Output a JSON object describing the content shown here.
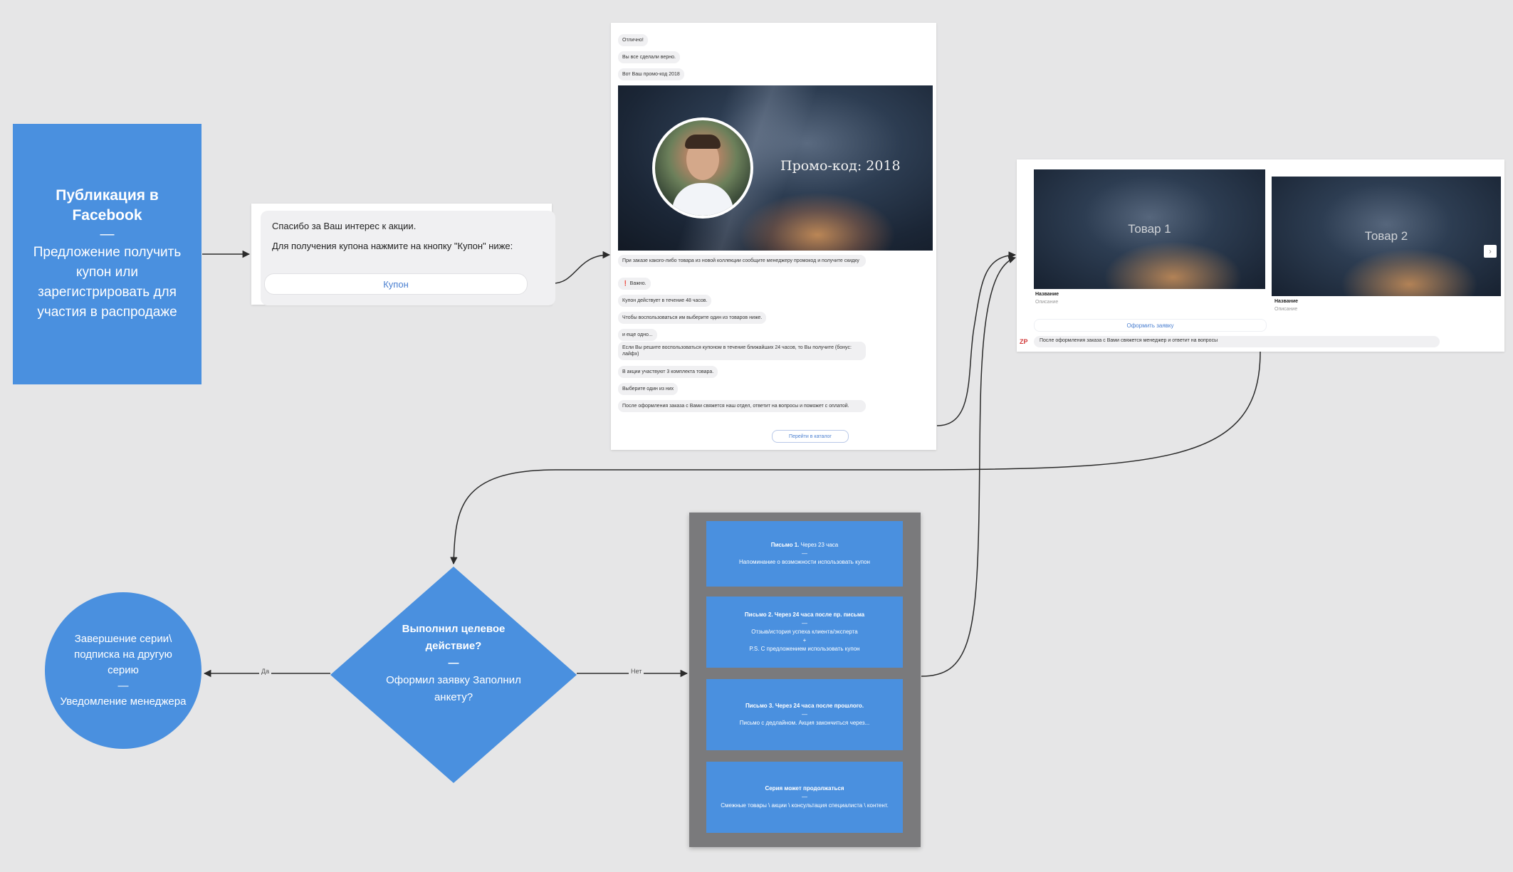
{
  "facebook_block": {
    "title": "Публикация в Facebook",
    "dash": "—",
    "subtitle": "Предложение получить купон или зарегистрировать для участия в распродаже"
  },
  "coupon_message": {
    "line1": "Спасибо за Ваш интерес к акции.",
    "line2": "Для получения купона нажмите на кнопку \"Купон\" ниже:",
    "button": "Купон"
  },
  "promo_chat": {
    "top_messages": [
      "Отлично!",
      "Вы все сделали верно.",
      "Вот Ваш промо-код 2018"
    ],
    "hero_text": "Промо-код: 2018",
    "messages": [
      "При заказе какого-либо товара из новой коллекции сообщите менеджеру промокод и получите скидку",
      "Важно.",
      "Купон действует в течение 48 часов.",
      "Чтобы воспользоваться им выберите один из товаров ниже.",
      "и еще одно...",
      "Если Вы решите воспользоваться купоном в течение ближайших 24 часов, то Вы получите (бонус: лайфх)",
      "В акции участвуют 3 комплекта товара.",
      "Выберите один из них",
      "После оформления заказа с Вами свяжется наш отдел, ответит на вопросы и поможет с оплатой."
    ],
    "catalog_button": "Перейти в каталог"
  },
  "products": {
    "items": [
      {
        "image_label": "Товар 1",
        "name": "Название",
        "desc": "Описание"
      },
      {
        "image_label": "Товар 2",
        "name": "Название",
        "desc": "Описание"
      }
    ],
    "order_button": "Оформить заявку",
    "logo": "ZP",
    "notice": "После оформления заказа с Вами свяжется менеджер и ответит на вопросы"
  },
  "decision": {
    "title": "Выполнил целевое действие?",
    "dash": "—",
    "subtitle": "Оформил заявку Заполнил анкету?"
  },
  "end_block": {
    "line1": "Завершение серии\\ подписка на другую серию",
    "dash": "—",
    "line2": "Уведомление менеджера"
  },
  "edges": {
    "yes": "Да",
    "no": "Нет"
  },
  "letters": [
    {
      "title": "Письмо 1.",
      "timing": "Через 23 часа",
      "dash": "—",
      "body": "Напоминание о возможности использовать купон"
    },
    {
      "title": "Письмо 2.",
      "timing": "Через 24 часа после пр. письма",
      "dash": "—",
      "body": "Отзыв/история успеха клиента/эксперта",
      "extra": "P.S. С предложением использовать купон"
    },
    {
      "title": "Письмо 3.",
      "timing": "Через 24 часа после прошлого.",
      "dash": "—",
      "body": "Письмо с дедлайном. Акция закончиться через..."
    },
    {
      "title": "Серия может продолжаться",
      "timing": "",
      "dash": "—",
      "body": "Смежные товары \\ акции \\ консультация специалиста \\ контент."
    }
  ],
  "colors": {
    "block_blue": "#4a90df",
    "canvas": "#e6e6e7",
    "series_bg": "#7a7a7c"
  }
}
